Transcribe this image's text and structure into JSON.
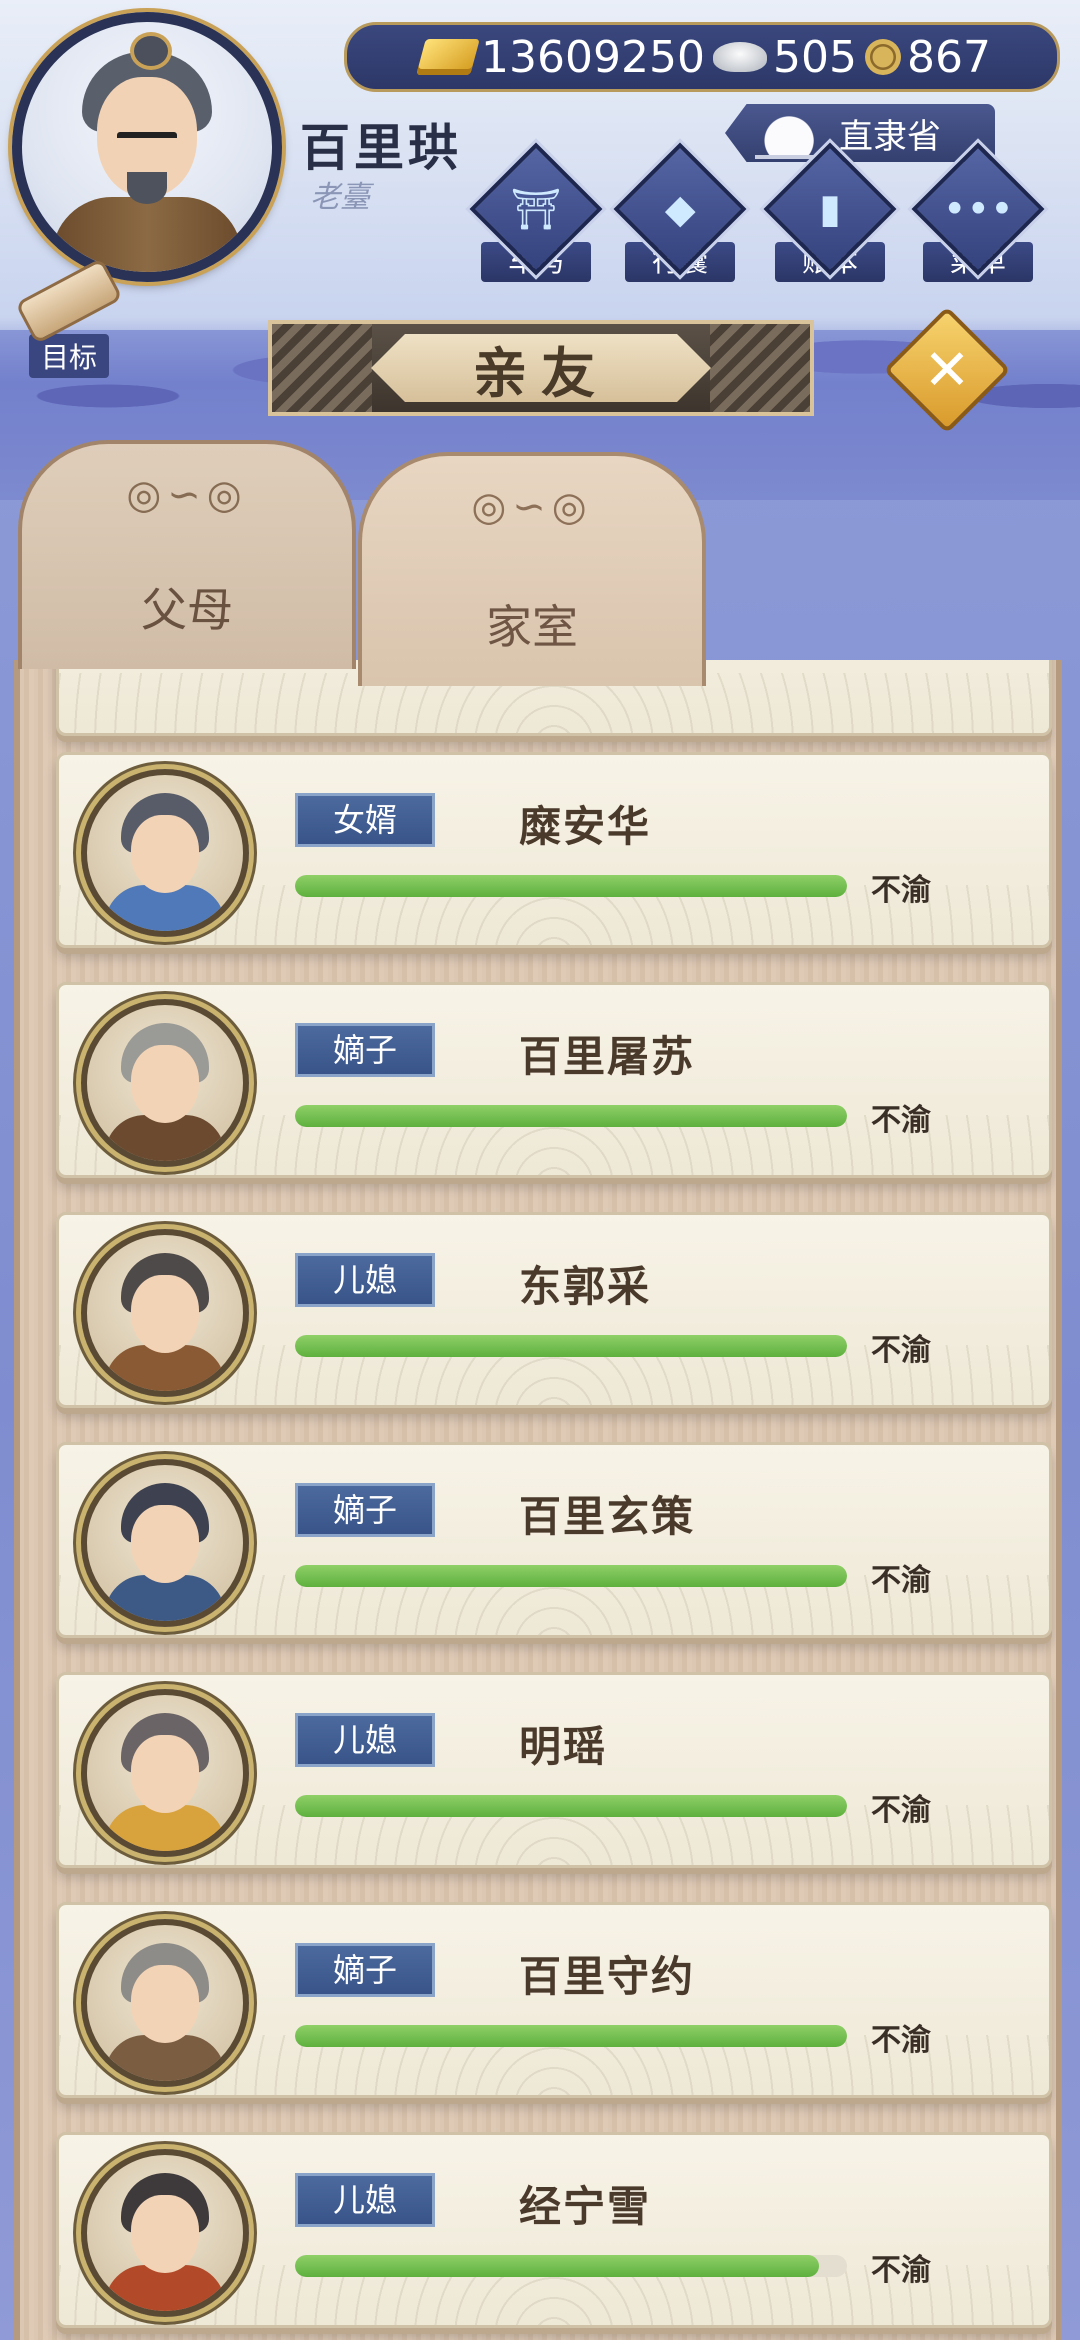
{
  "player": {
    "name": "百里珙",
    "subtitle": "老臺"
  },
  "currency": {
    "gold": "13609250",
    "silver": "505",
    "coin": "867"
  },
  "location": "直隶省",
  "nav": [
    {
      "label": "车马",
      "icon": "carriage-icon"
    },
    {
      "label": "行囊",
      "icon": "bundle-icon"
    },
    {
      "label": "账本",
      "icon": "ledger-icon"
    },
    {
      "label": "菜单",
      "icon": "menu-dots-icon"
    }
  ],
  "goal_label": "目标",
  "title": "亲友",
  "tabs": {
    "parents": "父母",
    "family": "家室"
  },
  "members": [
    {
      "role": "女婿",
      "name": "糜安华",
      "mood": "不渝",
      "bond": 1.0,
      "robe": "#4f79b8"
    },
    {
      "role": "嫡子",
      "name": "百里屠苏",
      "mood": "不渝",
      "bond": 1.0,
      "robe": "#6b4a30"
    },
    {
      "role": "儿媳",
      "name": "东郭采",
      "mood": "不渝",
      "bond": 1.0,
      "robe": "#8a5a34"
    },
    {
      "role": "嫡子",
      "name": "百里玄策",
      "mood": "不渝",
      "bond": 1.0,
      "robe": "#3d5a86"
    },
    {
      "role": "儿媳",
      "name": "明瑶",
      "mood": "不渝",
      "bond": 1.0,
      "robe": "#d8a23c"
    },
    {
      "role": "嫡子",
      "name": "百里守约",
      "mood": "不渝",
      "bond": 1.0,
      "robe": "#7b5d42"
    },
    {
      "role": "儿媳",
      "name": "经宁雪",
      "mood": "不渝",
      "bond": 0.95,
      "robe": "#b24a2a"
    }
  ]
}
